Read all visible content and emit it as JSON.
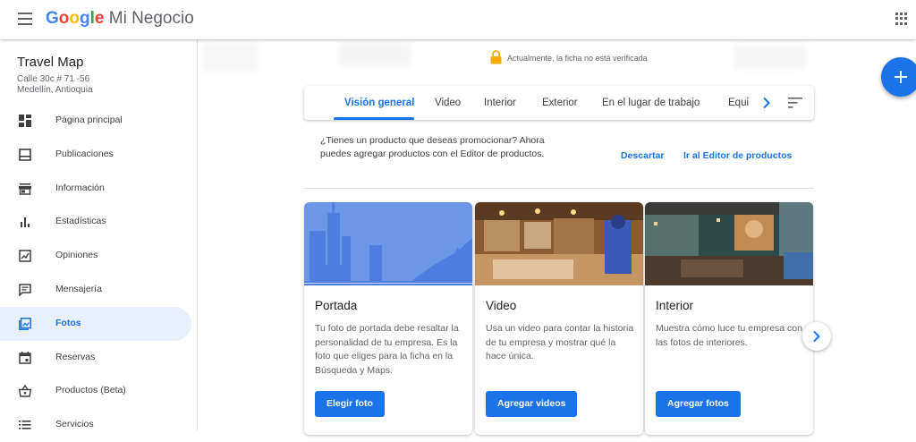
{
  "header": {
    "logo_google": "Google",
    "logo_product": "Mi Negocio"
  },
  "sidebar": {
    "business_name": "Travel Map",
    "address_line1": "Calle 30c # 71 -56",
    "address_line2": "Medellín, Antioquia",
    "items": [
      {
        "label": "Página principal",
        "icon": "dashboard-icon"
      },
      {
        "label": "Publicaciones",
        "icon": "posts-icon"
      },
      {
        "label": "Información",
        "icon": "storefront-icon"
      },
      {
        "label": "Estadísticas",
        "icon": "bar-chart-icon"
      },
      {
        "label": "Opiniones",
        "icon": "reviews-icon"
      },
      {
        "label": "Mensajería",
        "icon": "message-icon"
      },
      {
        "label": "Fotos",
        "icon": "photo-icon",
        "active": true
      },
      {
        "label": "Reservas",
        "icon": "calendar-icon"
      },
      {
        "label": "Productos (Beta)",
        "icon": "basket-icon"
      },
      {
        "label": "Servicios",
        "icon": "list-icon"
      }
    ]
  },
  "verification": {
    "text": "Actualmente, la ficha no está verificada"
  },
  "tabs": [
    {
      "label": "Visión general",
      "active": true
    },
    {
      "label": "Video"
    },
    {
      "label": "Interior"
    },
    {
      "label": "Exterior"
    },
    {
      "label": "En el lugar de trabajo"
    },
    {
      "label": "Equi"
    }
  ],
  "promo": {
    "text": "¿Tienes un producto que deseas promocionar? Ahora puedes agregar productos con el Editor de productos.",
    "dismiss_label": "Descartar",
    "editor_label": "Ir al Editor de productos"
  },
  "cards": [
    {
      "title": "Portada",
      "description": "Tu foto de portada debe resaltar la personalidad de tu empresa. Es la foto que eliges para la ficha en la Búsqueda y Maps.",
      "button": "Elegir foto"
    },
    {
      "title": "Video",
      "description": "Usa un video para contar la historia de tu empresa y mostrar qué la hace única.",
      "button": "Agregar videos"
    },
    {
      "title": "Interior",
      "description": "Muestra cómo luce tu empresa con las fotos de interiores.",
      "button": "Agregar fotos"
    }
  ],
  "colors": {
    "accent": "#1a73e8",
    "active_nav_bg": "#e8f0fe",
    "lock": "#f9ab00"
  }
}
